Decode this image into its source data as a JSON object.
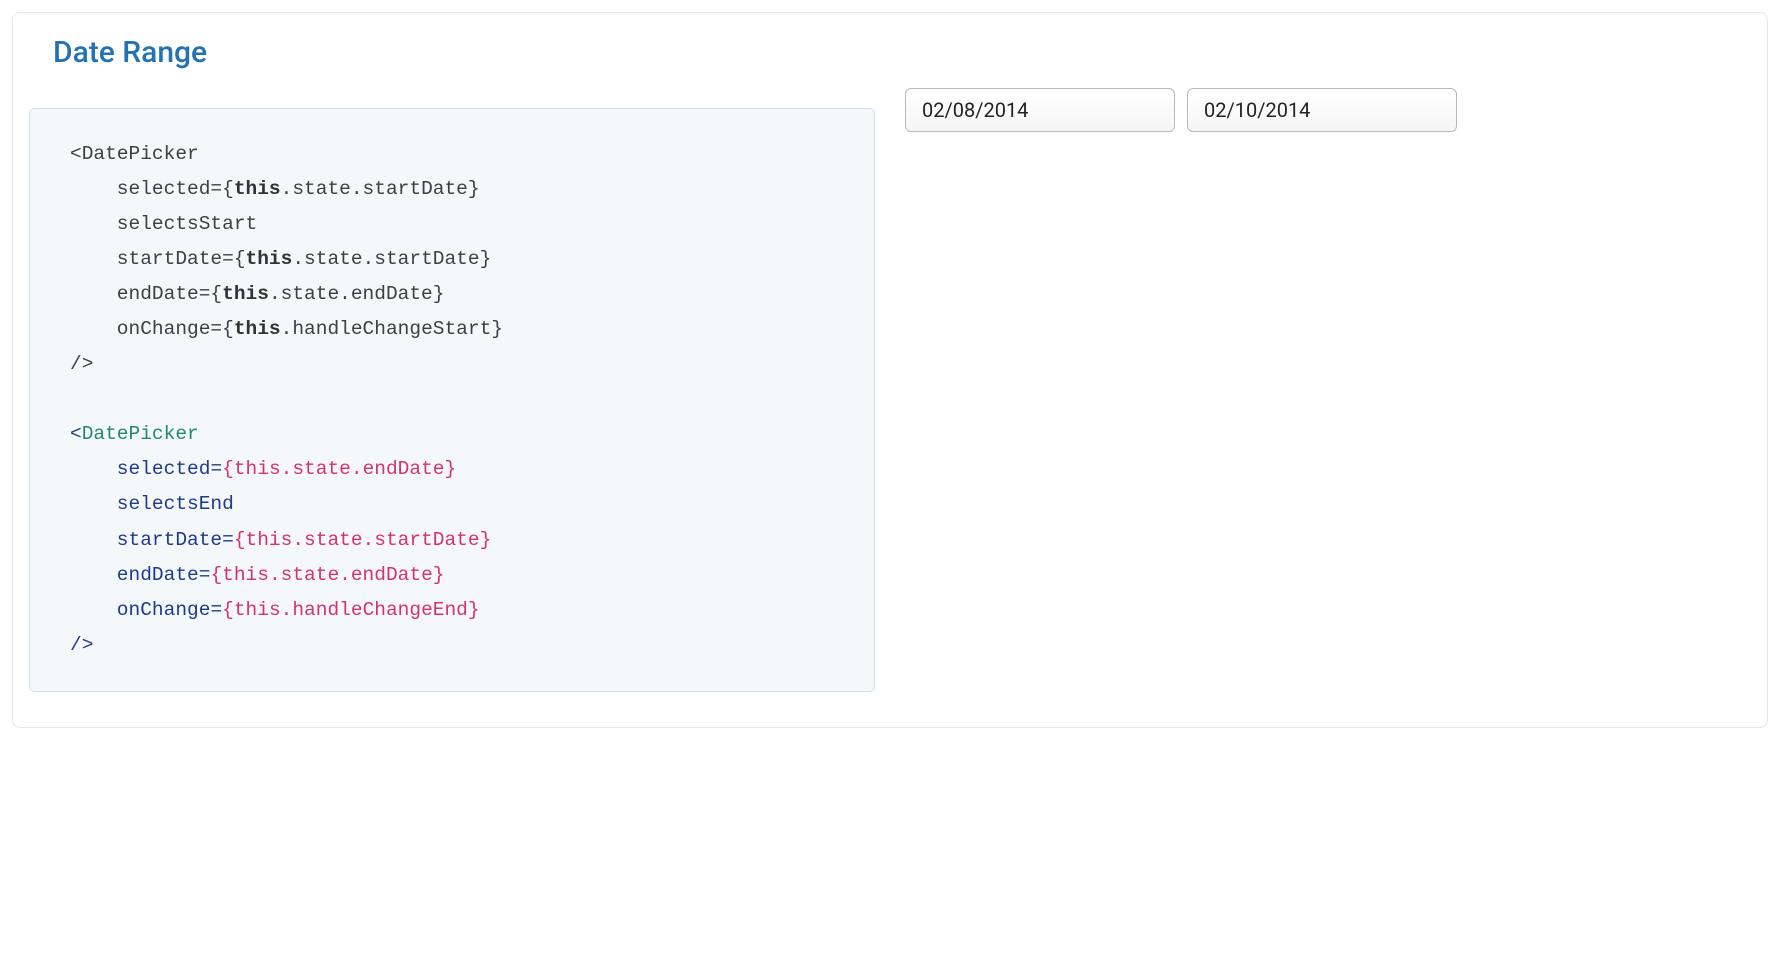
{
  "card": {
    "title": "Date Range"
  },
  "code": {
    "line1": "<DatePicker",
    "line2a": "    selected={",
    "line2b": "this",
    "line2c": ".state.startDate}",
    "line3": "    selectsStart",
    "line4a": "    startDate={",
    "line4b": "this",
    "line4c": ".state.startDate}",
    "line5a": "    endDate={",
    "line5b": "this",
    "line5c": ".state.endDate}",
    "line6a": "    onChange={",
    "line6b": "this",
    "line6c": ".handleChangeStart}",
    "line7": "/>",
    "blank": "",
    "bline1_open": "<",
    "bline1_tag": "DatePicker",
    "bline2_attr": "    selected",
    "bline2_eq": "=",
    "bline2_expr": "{this.state.endDate}",
    "bline3_attr": "    selectsEnd",
    "bline4_attr": "    startDate",
    "bline4_eq": "=",
    "bline4_expr": "{this.state.startDate}",
    "bline5_attr": "    endDate",
    "bline5_eq": "=",
    "bline5_expr": "{this.state.endDate}",
    "bline6_attr": "    onChange",
    "bline6_eq": "=",
    "bline6_expr": "{this.handleChangeEnd}",
    "bline7": "/>"
  },
  "preview": {
    "start_date": "02/08/2014",
    "end_date": "02/10/2014"
  }
}
